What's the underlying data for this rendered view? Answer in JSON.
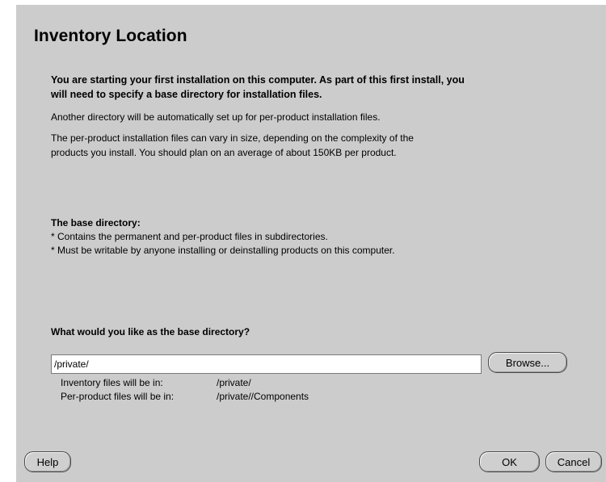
{
  "title": "Inventory Location",
  "intro": {
    "bold_line_1": "You are starting your first installation on this computer. As part of this first install, you",
    "bold_line_2": "will need to specify a base directory for installation files.",
    "line_3": "Another directory will be automatically set up for per-product installation files.",
    "line_4": "The per-product installation files can vary in size, depending on the complexity of the",
    "line_5": "products you install.  You should plan on an average of about 150KB per product."
  },
  "base_directory": {
    "heading": "The base directory:",
    "bullet_1": "* Contains the permanent and per-product files in subdirectories.",
    "bullet_2": "* Must be writable by anyone installing or deinstalling products on this computer."
  },
  "question": "What would you like as the base directory?",
  "directory_input": {
    "value": "/private/"
  },
  "browse_label": "Browse...",
  "info": {
    "inventory_label": "Inventory files will be in:",
    "inventory_value": "/private/",
    "per_product_label": "Per-product files will be in:",
    "per_product_value": "/private//Components"
  },
  "buttons": {
    "help": "Help",
    "ok": "OK",
    "cancel": "Cancel"
  }
}
